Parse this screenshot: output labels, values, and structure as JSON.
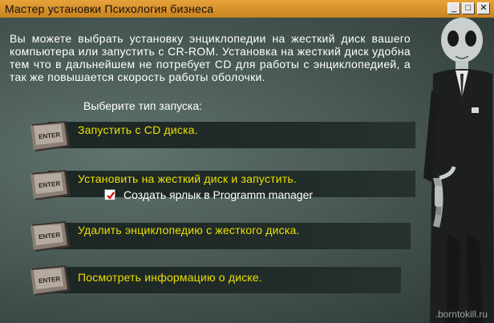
{
  "window": {
    "title": "Мастер установки  Психология бизнеса"
  },
  "titlebar_buttons": {
    "minimize": "_",
    "maximize": "□",
    "close": "✕"
  },
  "main": {
    "description": "Вы можете выбрать установку энциклопедии на жесткий диск вашего компьютера или запустить с CR-ROM. Установка на жесткий диск удобна тем что в дальнейшем не потребует CD для работы с энциклопедией, а так же повышается скорость работы оболочки.",
    "prompt": "Выберите тип запуска:",
    "key_label": "ENTER",
    "options": [
      {
        "label": "Запустить с CD диска."
      },
      {
        "label": "Установить на жесткий диск и запустить."
      },
      {
        "label": "Удалить энциклопедию с жесткого диска."
      },
      {
        "label": "Посмотреть информацию о диске."
      }
    ],
    "shortcut_checkbox": {
      "label": "Создать ярлык в Programm manager",
      "checked": true
    }
  },
  "watermark": ".borntokill.ru"
}
